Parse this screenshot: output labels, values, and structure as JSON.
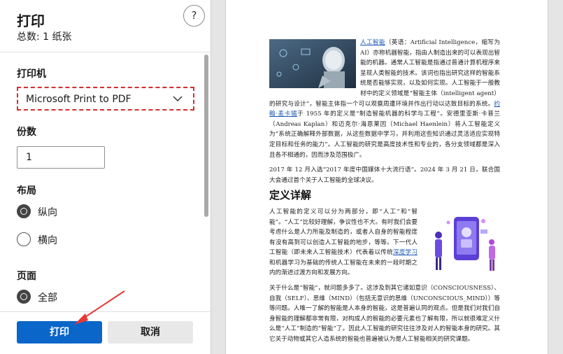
{
  "dialog": {
    "title": "打印",
    "subtitle": "总数: 1 纸张",
    "help_label": "?"
  },
  "printer": {
    "section_label": "打印机",
    "selected": "Microsoft Print to PDF"
  },
  "copies": {
    "section_label": "份数",
    "value": "1"
  },
  "layout": {
    "section_label": "布局",
    "options": [
      {
        "label": "纵向",
        "checked": true
      },
      {
        "label": "横向",
        "checked": false
      }
    ]
  },
  "pages": {
    "section_label": "页面",
    "options": [
      {
        "label": "全部",
        "checked": true
      }
    ]
  },
  "footer": {
    "print_label": "打印",
    "cancel_label": "取消"
  },
  "preview": {
    "p1_link": "人工智能",
    "p1_text": "（英语：Artificial Intelligence，缩写为 AI）亦称机器智能，指由人制造出来的可以表现出智能的机器。通常人工智能是指通过普通计算机程序来呈现人类智能的技术。该词也指出研究这样的智能系统是否能够实现，以及如何实现。人工智能于一般教材中的定义领域是“智能主体（intelligent agent）的研究与设计”，智能主体指一个可以观察周遭环境并作出行动以达致目标的系统。",
    "p1_link2": "约翰·麦卡锡",
    "p1_text2": "于 1955 年的定义是“制造智能机器的科学与工程”。安德里亚斯·卡普兰（Andreas Kaplan）和迈克尔·海恩莱因（Michael Haenlein）将人工智能定义为“系统正确解释外部数据，从这些数据中学习，并利用这些知识通过灵活适应实现特定目标和任务的能力”。人工智能的研究是高度技术性和专业的，各分支领域都是深入且各不相通的，因而涉及范围极广。",
    "p2": "2017 年 12 月入选“2017 年度中国媒体十大流行语”。2024 年 3 月 21 日，联合国大会通过首个关于人工智能的全球决议。",
    "heading": "定义详解",
    "p3_a": "人工智能的定义可以分为两部分，即“人工”和“智能”。“人工”比较好理解，争议性也不大。有时我们会要考虑什么是人力所能及制造的，或者人自身的智能程度有没有高到可以创造人工智能的地步，等等。下一代人工智能（即未来人工智能技术）代表着以传统",
    "p3_link": "深度学习",
    "p3_b": "和机器学习为基础的传统人工智能在未来的一段时期之内的渐进过渡方向和发展方向。",
    "p4": "关于什么是“智能”，就问题多多了。这涉及到其它诸如意识（CONSCIOUSNESS）、自我（SELF）、思维（MIND）（包括无意识的思维（UNCONSCIOUS_MIND））等等问题。人唯一了解的智能是人本身的智能，这是普遍认同的观点。但是我们对我们自身智能的理解都非常有限，对构成人的智能的必要元素也了解有限，所以就很难定义什么是“人工”制造的“智能”了。因此人工智能的研究往往涉及对人的智能本身的研究。其它关于动物或其它人造系统的智能也普遍被认为是人工智能相关的研究课题。"
  },
  "colors": {
    "primary": "#0a66c9",
    "highlight_border": "#d32f2f",
    "annotation_arrow": "#e53935"
  }
}
